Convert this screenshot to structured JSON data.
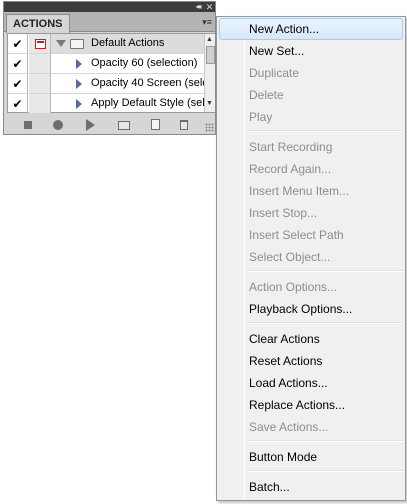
{
  "panel": {
    "tab_label": "ACTIONS",
    "collapse_glyph": "◂◂",
    "close_glyph": "✕",
    "menu_glyph": "▾≡",
    "rows": [
      {
        "check": "✔",
        "type": "set",
        "label": "Default Actions"
      },
      {
        "check": "✔",
        "type": "action",
        "label": "Opacity 60 (selection)"
      },
      {
        "check": "✔",
        "type": "action",
        "label": "Opacity 40 Screen (sele..."
      },
      {
        "check": "✔",
        "type": "action",
        "label": "Apply Default Style (sel..."
      }
    ],
    "bottom_buttons": [
      "stop-icon",
      "record-icon",
      "play-icon",
      "new-set-icon",
      "new-action-icon",
      "delete-icon"
    ]
  },
  "menu": {
    "items": [
      {
        "label": "New Action...",
        "enabled": true
      },
      {
        "label": "New Set...",
        "enabled": true
      },
      {
        "label": "Duplicate",
        "enabled": false
      },
      {
        "label": "Delete",
        "enabled": false
      },
      {
        "label": "Play",
        "enabled": false
      },
      {
        "label": "Start Recording",
        "enabled": false
      },
      {
        "label": "Record Again...",
        "enabled": false
      },
      {
        "label": "Insert Menu Item...",
        "enabled": false
      },
      {
        "label": "Insert Stop...",
        "enabled": false
      },
      {
        "label": "Insert Select Path",
        "enabled": false
      },
      {
        "label": "Select Object...",
        "enabled": false
      },
      {
        "label": "Action Options...",
        "enabled": false
      },
      {
        "label": "Playback Options...",
        "enabled": true
      },
      {
        "label": "Clear Actions",
        "enabled": true
      },
      {
        "label": "Reset Actions",
        "enabled": true
      },
      {
        "label": "Load Actions...",
        "enabled": true
      },
      {
        "label": "Replace Actions...",
        "enabled": true
      },
      {
        "label": "Save Actions...",
        "enabled": false
      },
      {
        "label": "Button Mode",
        "enabled": true
      },
      {
        "label": "Batch...",
        "enabled": true
      }
    ],
    "hovered_item": "New Action..."
  },
  "colors": {
    "disabled_text": "#8d8d8d",
    "hover_border": "#a8cbef",
    "dialog_icon_red": "#c02020"
  }
}
